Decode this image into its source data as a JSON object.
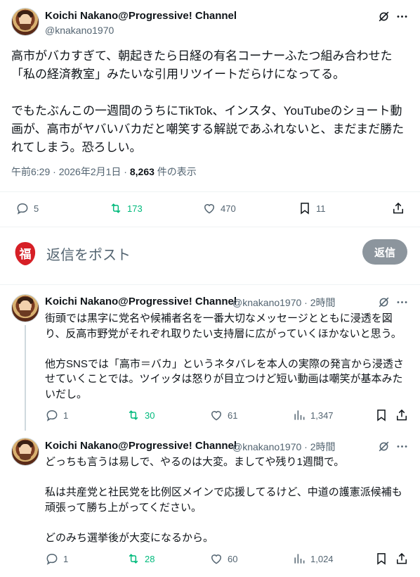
{
  "main_post": {
    "author": "Koichi Nakano@Progressive! Channel",
    "handle": "@knakano1970",
    "text": "高市がバカすぎて、朝起きたら日経の有名コーナーふたつ組み合わせた「私の経済教室」みたいな引用リツイートだらけになってる。\n\nでもたぶんこの一週間のうちにTikTok、インスタ、YouTubeのショート動画が、高市がヤバいバカだと嘲笑する解説であふれないと、まだまだ勝たれてしまう。恐ろしい。",
    "time": "午前6:29 · 2026年2月1日 · ",
    "views": "8,263",
    "views_suffix": " 件の表示",
    "replies": "5",
    "reposts": "173",
    "likes": "470",
    "bookmarks": "11"
  },
  "compose": {
    "placeholder": "返信をポスト",
    "button": "返信"
  },
  "replies": [
    {
      "author": "Koichi Nakano@Progressive! Channel",
      "handle_time": "@knakano1970 · 2時間",
      "text": "街頭では黒字に党名や候補者名を一番大切なメッセージとともに浸透を図り、反高市野党がそれぞれ取りたい支持層に広がっていくほかないと思う。\n\n他方SNSでは「高市＝バカ」というネタバレを本人の実際の発言から浸透させていくことでは。ツイッタは怒りが目立つけど短い動画は嘲笑が基本みたいだし。",
      "replies": "1",
      "reposts": "30",
      "likes": "61",
      "views": "1,347"
    },
    {
      "author": "Koichi Nakano@Progressive! Channel",
      "handle_time": "@knakano1970 · 2時間",
      "text": "どっちも言うは易しで、やるのは大変。ましてや残り1週間で。\n\n私は共産党と社民党を比例区メインで応援してるけど、中道の護憲派候補も頑張って勝ち上がってください。\n\nどのみち選挙後が大変になるから。",
      "replies": "1",
      "reposts": "28",
      "likes": "60",
      "views": "1,024"
    }
  ],
  "colors": {
    "text": "#0f1419",
    "secondary": "#536471",
    "repost_green": "#00ba7c",
    "divider": "#eff3f4"
  },
  "icons": [
    "grok-icon",
    "more-icon",
    "reply-icon",
    "repost-icon",
    "like-icon",
    "bookmark-icon",
    "share-icon",
    "views-icon"
  ]
}
